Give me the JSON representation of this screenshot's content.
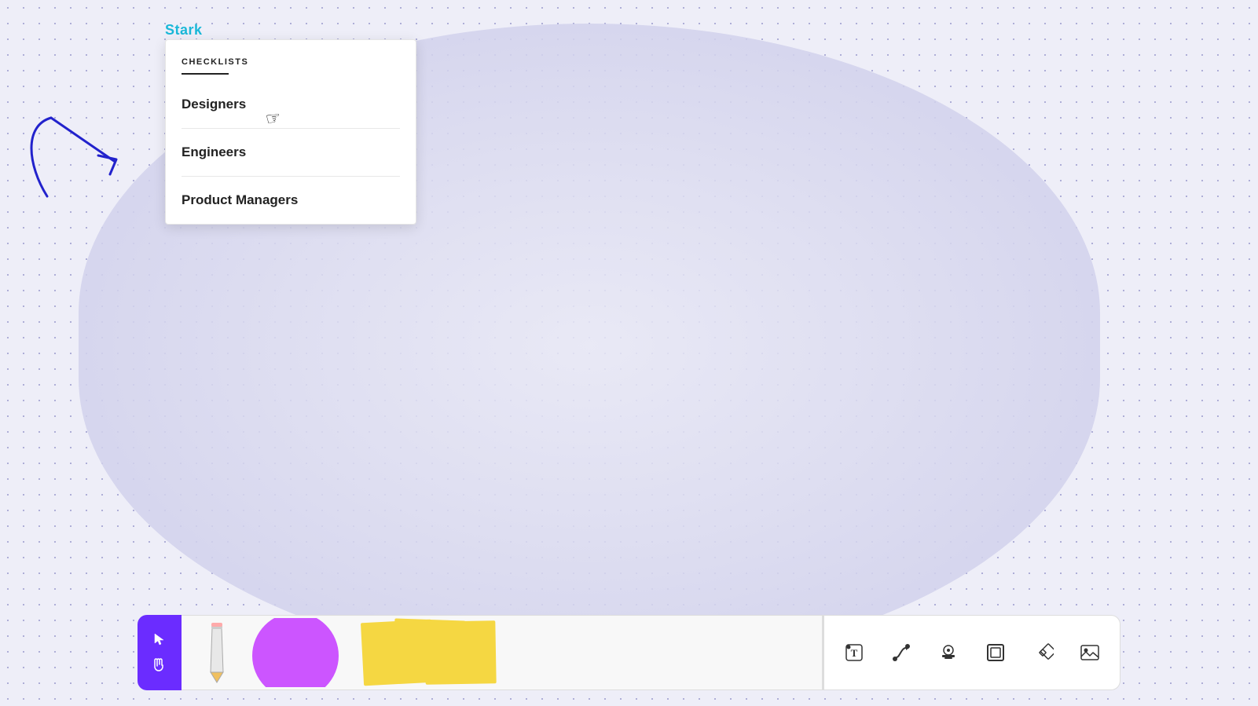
{
  "app": {
    "title": "Stark"
  },
  "dropdown": {
    "header": "CHECKLISTS",
    "items": [
      {
        "id": "designers",
        "label": "Designers"
      },
      {
        "id": "engineers",
        "label": "Engineers"
      },
      {
        "id": "product-managers",
        "label": "Product Managers"
      }
    ]
  },
  "toolbar": {
    "left_tools": [
      {
        "id": "cursor",
        "label": "Cursor",
        "active": true,
        "icon": "▶"
      },
      {
        "id": "hand",
        "label": "Hand",
        "active": false,
        "icon": "✋"
      }
    ],
    "right_tools": [
      {
        "id": "text",
        "label": "Text",
        "icon": "T"
      },
      {
        "id": "connector",
        "label": "Connector",
        "icon": "connector"
      },
      {
        "id": "stamp",
        "label": "Stamp",
        "icon": "stamp"
      },
      {
        "id": "frame",
        "label": "Frame",
        "icon": "frame"
      },
      {
        "id": "component",
        "label": "Component",
        "icon": "diamond"
      },
      {
        "id": "image",
        "label": "Image",
        "icon": "image"
      }
    ]
  }
}
